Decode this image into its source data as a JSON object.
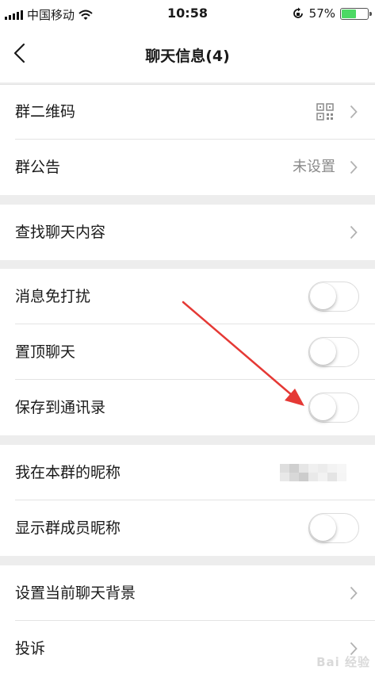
{
  "status_bar": {
    "carrier": "中国移动",
    "time": "10:58",
    "battery_percent": "57%",
    "battery_level": 0.57,
    "icons": [
      "signal-icon",
      "wifi-icon",
      "rotation-lock-icon",
      "battery-icon"
    ]
  },
  "nav": {
    "title": "聊天信息(4)",
    "back_icon": "chevron-left-icon"
  },
  "settings": {
    "qr_code": {
      "label": "群二维码",
      "icon": "qr-code-icon"
    },
    "announcement": {
      "label": "群公告",
      "value": "未设置"
    },
    "search_chat": {
      "label": "查找聊天内容"
    },
    "mute": {
      "label": "消息免打扰",
      "on": false
    },
    "pin": {
      "label": "置顶聊天",
      "on": false
    },
    "save_contacts": {
      "label": "保存到通讯录",
      "on": false
    },
    "my_nickname": {
      "label": "我在本群的昵称"
    },
    "show_nicknames": {
      "label": "显示群成员昵称",
      "on": false
    },
    "background": {
      "label": "设置当前聊天背景"
    },
    "complaint": {
      "label": "投诉"
    }
  },
  "colors": {
    "background": "#ededed",
    "row": "#ffffff",
    "annotation_arrow": "#e53935",
    "battery_fill": "#4cd964"
  },
  "watermark": "Bai 经验"
}
